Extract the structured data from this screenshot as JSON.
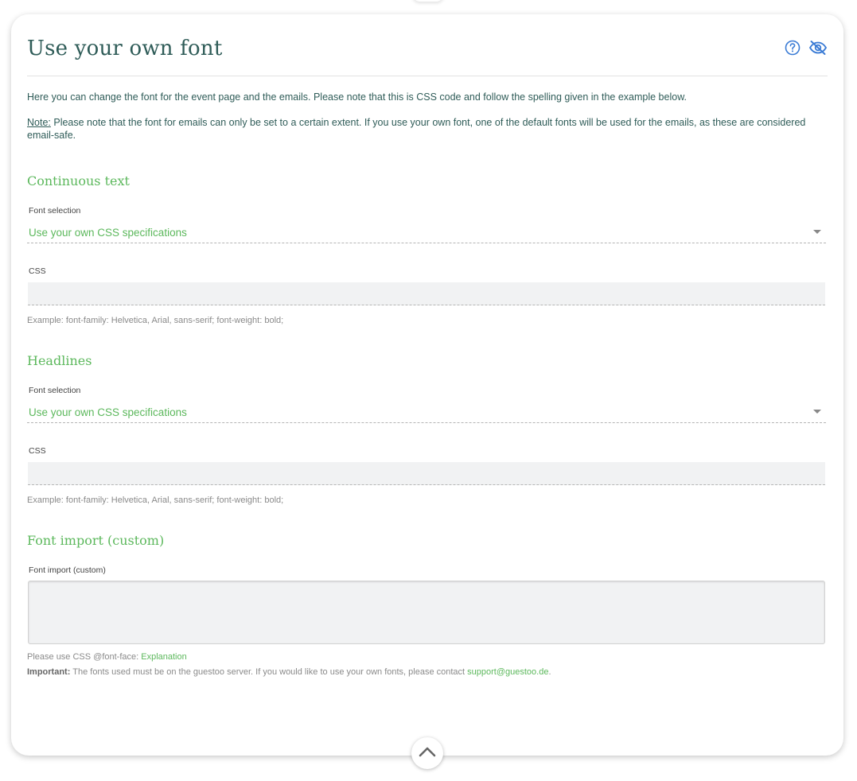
{
  "header": {
    "title": "Use your own font",
    "help_icon": "question-circle-icon",
    "visibility_icon": "eye-slash-icon",
    "accent": "#3a7bd5"
  },
  "intro": {
    "text": "Here you can change the font for the event page and the emails. Please note that this is CSS code and follow the spelling given in the example below.",
    "note_label": "Note:",
    "note_text": " Please note that the font for emails can only be set to a certain extent. If you use your own font, one of the default fonts will be used for the emails, as these are considered email-safe."
  },
  "continuous_text": {
    "title": "Continuous text",
    "font_selection_label": "Font selection",
    "font_selection_value": "Use your own CSS specifications",
    "css_label": "CSS",
    "css_value": "",
    "example": "Example: font-family: Helvetica, Arial, sans-serif; font-weight: bold;"
  },
  "headlines": {
    "title": "Headlines",
    "font_selection_label": "Font selection",
    "font_selection_value": "Use your own CSS specifications",
    "css_label": "CSS",
    "css_value": "",
    "example": "Example: font-family: Helvetica, Arial, sans-serif; font-weight: bold;"
  },
  "font_import": {
    "title": "Font import (custom)",
    "label": "Font import (custom)",
    "value": "",
    "hint_prefix": "Please use CSS @font-face: ",
    "hint_link": "Explanation",
    "important_label": "Important:",
    "important_text": " The fonts used must be on the guestoo server. If you would like to use your own fonts, please contact ",
    "support_email": "support@guestoo.de",
    "important_suffix": "."
  },
  "footer": {
    "collapse_icon": "chevron-up-icon"
  },
  "colors": {
    "title": "#2f5c58",
    "accent_green": "#5cb85c",
    "icon_blue": "#3a7bd5"
  }
}
